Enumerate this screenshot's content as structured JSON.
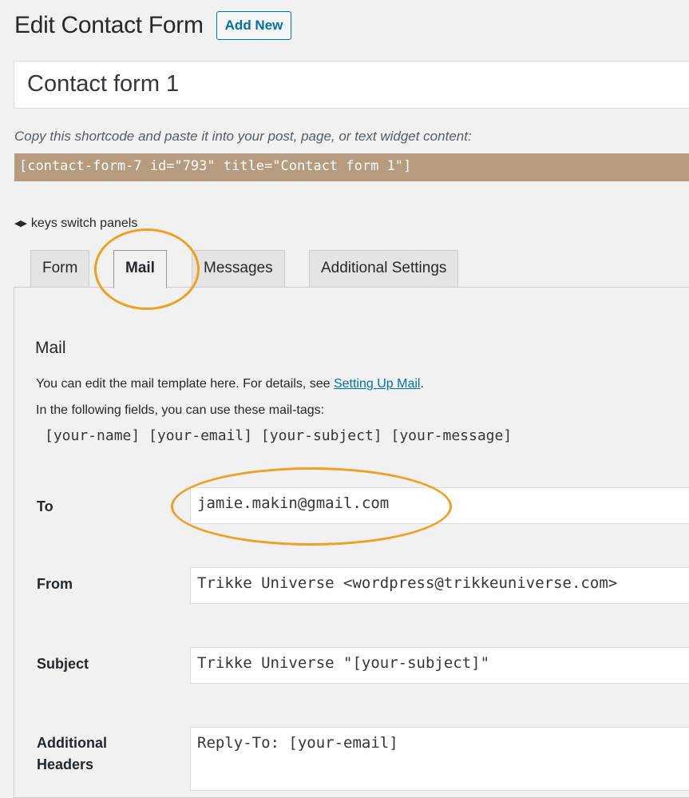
{
  "header": {
    "title": "Edit Contact Form",
    "add_new": "Add New"
  },
  "form_title_value": "Contact form 1",
  "shortcode": {
    "hint": "Copy this shortcode and paste it into your post, page, or text widget content:",
    "code": "[contact-form-7 id=\"793\" title=\"Contact form 1\"]"
  },
  "keys_hint": {
    "arrows": "◀▶",
    "text": "keys switch panels"
  },
  "tabs": [
    {
      "label": "Form",
      "active": false
    },
    {
      "label": "Mail",
      "active": true
    },
    {
      "label": "Messages",
      "active": false
    },
    {
      "label": "Additional Settings",
      "active": false
    }
  ],
  "mail": {
    "heading": "Mail",
    "desc_prefix": "You can edit the mail template here. For details, see ",
    "desc_link": "Setting Up Mail",
    "desc_suffix": ".",
    "tags_intro": "In the following fields, you can use these mail-tags:",
    "tags": "[your-name] [your-email] [your-subject] [your-message]",
    "fields": {
      "to": {
        "label": "To",
        "value": "jamie.makin@gmail.com"
      },
      "from": {
        "label": "From",
        "value": "Trikke Universe <wordpress@trikkeuniverse.com>"
      },
      "subject": {
        "label": "Subject",
        "value": "Trikke Universe \"[your-subject]\""
      },
      "additional_headers": {
        "label_line1": "Additional",
        "label_line2": "Headers",
        "value": "Reply-To: [your-email]"
      }
    }
  },
  "colors": {
    "highlight_ring": "#f0a020",
    "shortcode_bg": "#b79b7e",
    "link": "#0073aa"
  }
}
